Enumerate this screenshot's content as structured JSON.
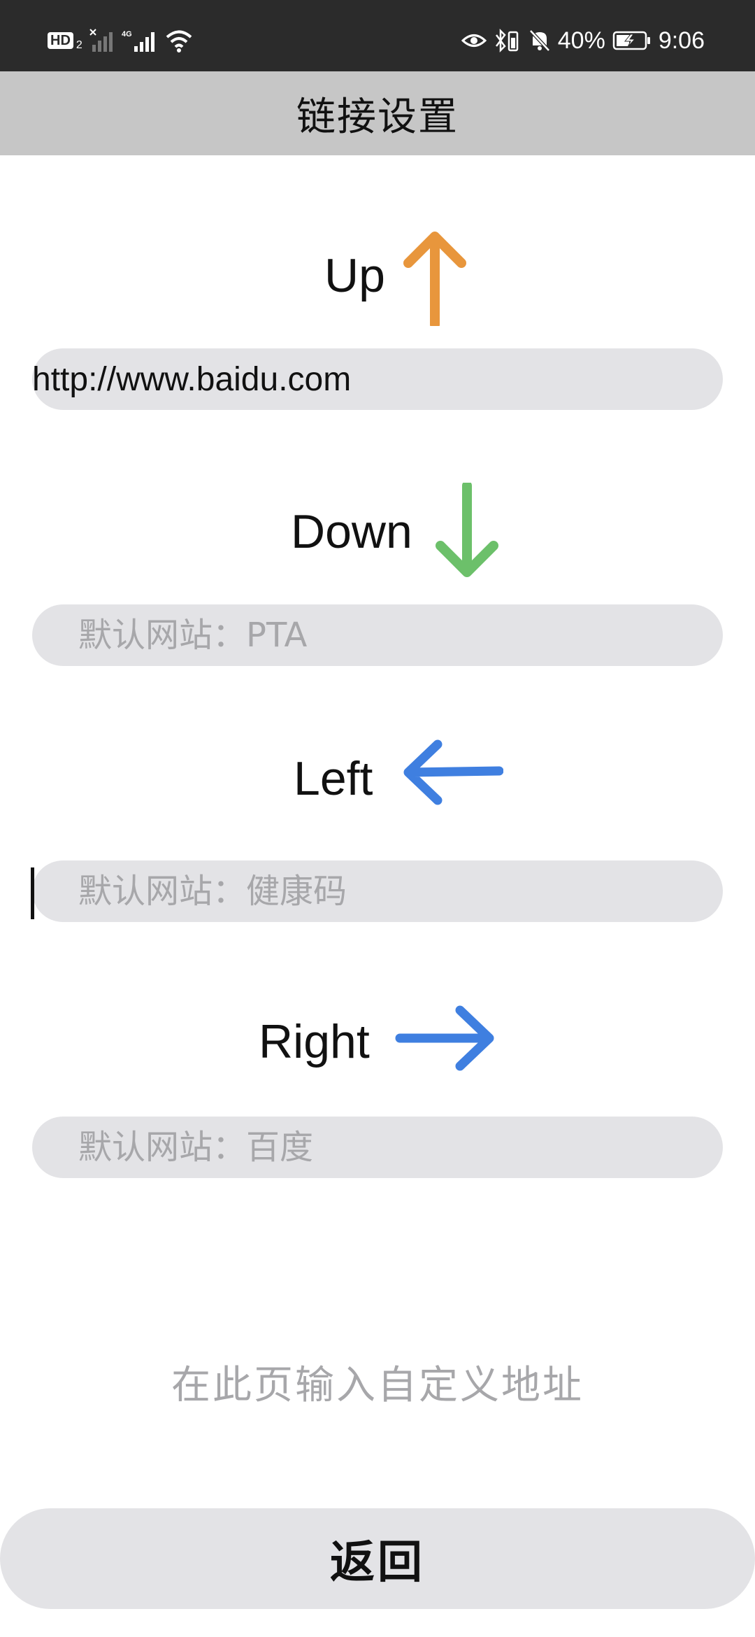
{
  "status_bar": {
    "hd_label": "HD",
    "hd_sub": "2",
    "battery_percent": "40%",
    "time": "9:06"
  },
  "header": {
    "title": "链接设置"
  },
  "directions": [
    {
      "label": "Up",
      "value": "http://www.baidu.com",
      "placeholder": "",
      "arrow_color": "#E8963C"
    },
    {
      "label": "Down",
      "value": "",
      "placeholder": "默认网站：PTA",
      "arrow_color": "#6CC06A"
    },
    {
      "label": "Left",
      "value": "",
      "placeholder": "默认网站：健康码",
      "arrow_color": "#3F7FE0"
    },
    {
      "label": "Right",
      "value": "",
      "placeholder": "默认网站：百度",
      "arrow_color": "#3F7FE0"
    }
  ],
  "hint": "在此页输入自定义地址",
  "back_button_label": "返回"
}
